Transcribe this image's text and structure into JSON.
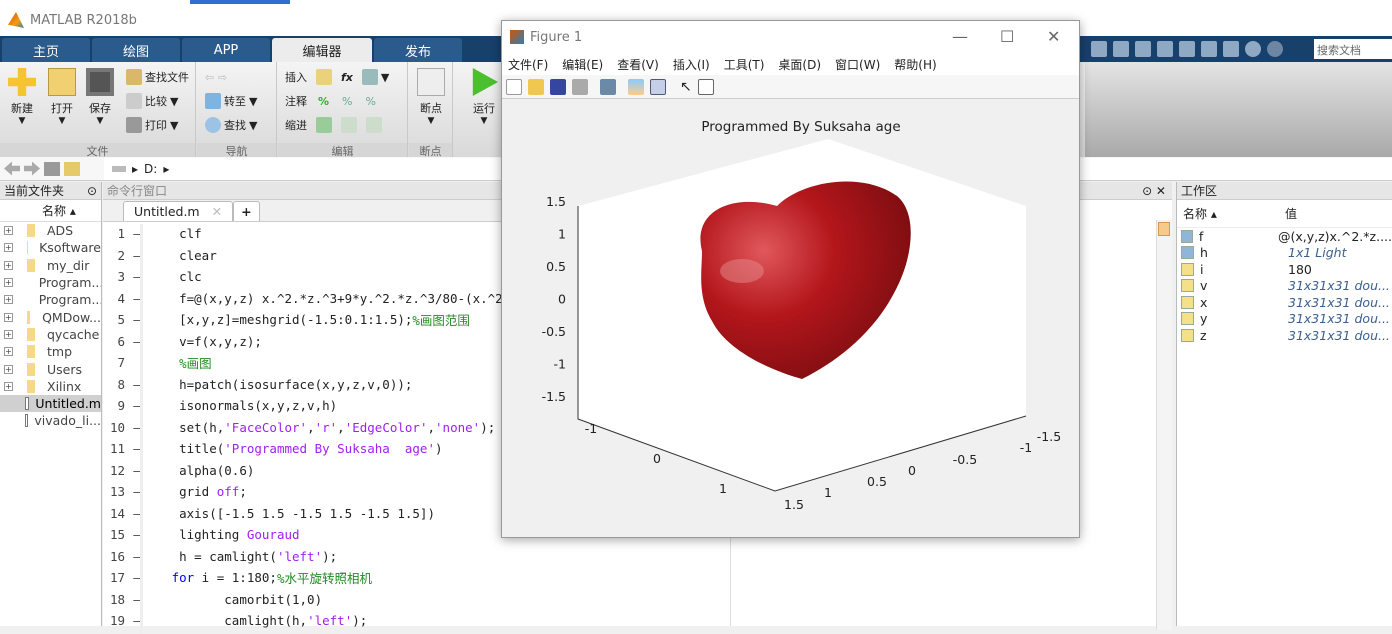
{
  "app": {
    "title": "MATLAB R2018b"
  },
  "tabs": [
    {
      "label": "主页"
    },
    {
      "label": "绘图"
    },
    {
      "label": "APP"
    },
    {
      "label": "编辑器"
    },
    {
      "label": "发布"
    }
  ],
  "quick_access": {
    "search_placeholder": "搜索文档"
  },
  "ribbon": {
    "file": {
      "label": "文件",
      "new": "新建",
      "open": "打开",
      "save": "保存",
      "find_files": "查找文件",
      "compare": "比较",
      "print": "打印"
    },
    "navigate": {
      "label": "导航",
      "goto": "转至",
      "find": "查找"
    },
    "edit": {
      "label": "编辑",
      "insert": "插入",
      "comment": "注释",
      "indent": "缩进"
    },
    "breakpoints": {
      "label": "断点",
      "button": "断点"
    },
    "run": {
      "button": "运行"
    }
  },
  "address": {
    "path": "D:"
  },
  "current_folder": {
    "title": "当前文件夹",
    "col_name": "名称",
    "items": [
      {
        "name": "ADS"
      },
      {
        "name": "Ksoftware"
      },
      {
        "name": "my_dir"
      },
      {
        "name": "Program..."
      },
      {
        "name": "Program..."
      },
      {
        "name": "QMDow..."
      },
      {
        "name": "qycache"
      },
      {
        "name": "tmp"
      },
      {
        "name": "Users"
      },
      {
        "name": "Xilinx"
      }
    ],
    "files": [
      {
        "name": "Untitled.m"
      },
      {
        "name": "vivado_li..."
      }
    ]
  },
  "command_window": {
    "title": "命令行窗口"
  },
  "editor": {
    "tab": "Untitled.m",
    "plus": "+",
    "lines": [
      {
        "n": "1",
        "code": "clf"
      },
      {
        "n": "2",
        "code": "clear"
      },
      {
        "n": "3",
        "code": "clc"
      },
      {
        "n": "4",
        "code": "f=@(x,y,z) x.^2.*z.^3+9*y.^2.*z.^3/80-(x.^2+"
      },
      {
        "n": "5",
        "code": "[x,y,z]=meshgrid(-1.5:0.1:1.5);",
        "comment": "%画图范围"
      },
      {
        "n": "6",
        "code": "v=f(x,y,z);"
      },
      {
        "n": "7",
        "code": "",
        "comment": "%画图"
      },
      {
        "n": "8",
        "code": "h=patch(isosurface(x,y,z,v,0));"
      },
      {
        "n": "9",
        "code": "isonormals(x,y,z,v,h)"
      },
      {
        "n": "10",
        "code": "set(h,",
        "s1": "'FaceColor'",
        "c2": ",",
        "s2": "'r'",
        "c3": ",",
        "s3": "'EdgeColor'",
        "c4": ",",
        "s4": "'none'",
        "c5": ");"
      },
      {
        "n": "11",
        "code": "title(",
        "s1": "'Programmed By Suksaha  age'",
        "c2": ")"
      },
      {
        "n": "12",
        "code": "alpha(0.6)"
      },
      {
        "n": "13",
        "code": "grid ",
        "s1": "off",
        "c2": ";"
      },
      {
        "n": "14",
        "code": "axis([-1.5 1.5 -1.5 1.5 -1.5 1.5])"
      },
      {
        "n": "15",
        "code": "lighting ",
        "s1": "Gouraud"
      },
      {
        "n": "16",
        "code": "h = camlight(",
        "s1": "'left'",
        "c2": ");"
      },
      {
        "n": "17",
        "kw": "for",
        "code": " i = 1:180;",
        "comment": "%水平旋转照相机"
      },
      {
        "n": "18",
        "code": "camorbit(1,0)"
      },
      {
        "n": "19",
        "code": "camlight(h,",
        "s1": "'left'",
        "c2": ");"
      }
    ]
  },
  "workspace": {
    "title": "工作区",
    "col_name": "名称",
    "col_value": "值",
    "vars": [
      {
        "name": "f",
        "value": "@(x,y,z)x.^2.*z....",
        "type": "obj"
      },
      {
        "name": "h",
        "value": "1x1 Light",
        "type": "obj",
        "italic": true
      },
      {
        "name": "i",
        "value": "180",
        "type": "num"
      },
      {
        "name": "v",
        "value": "31x31x31 dou...",
        "type": "num",
        "italic": true
      },
      {
        "name": "x",
        "value": "31x31x31 dou...",
        "type": "num",
        "italic": true
      },
      {
        "name": "y",
        "value": "31x31x31 dou...",
        "type": "num",
        "italic": true
      },
      {
        "name": "z",
        "value": "31x31x31 dou...",
        "type": "num",
        "italic": true
      }
    ]
  },
  "figure": {
    "title": "Figure 1",
    "menu": [
      "文件(F)",
      "编辑(E)",
      "查看(V)",
      "插入(I)",
      "工具(T)",
      "桌面(D)",
      "窗口(W)",
      "帮助(H)"
    ],
    "plot_title": "Programmed By Suksaha  age",
    "z_ticks": [
      "1.5",
      "1",
      "0.5",
      "0",
      "-0.5",
      "-1",
      "-1.5"
    ],
    "x_ticks": [
      "-1",
      "0",
      "1"
    ],
    "y_ticks": [
      "-1.5",
      "-1",
      "-0.5",
      "0",
      "0.5",
      "1",
      "1.5"
    ],
    "surface_color": "#b3161b"
  }
}
